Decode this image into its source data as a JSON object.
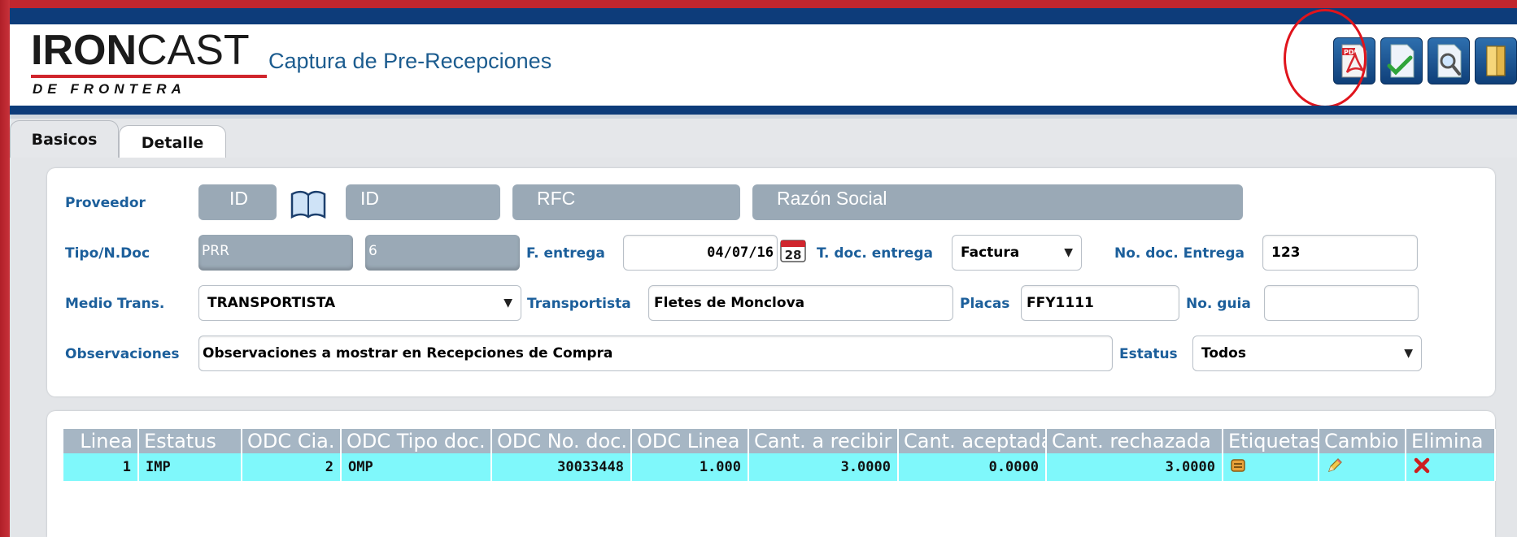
{
  "header": {
    "logo_main_bold": "IRON",
    "logo_main_regular": "CAST",
    "logo_sub": "DE FRONTERA",
    "title": "Captura de Pre-Recepciones",
    "toolbar_icons": [
      "pdf-icon",
      "document-check-icon",
      "magnifier-icon",
      "exit-door-icon"
    ]
  },
  "tabs": [
    {
      "label": "Basicos",
      "active": true
    },
    {
      "label": "Detalle",
      "active": false
    }
  ],
  "form": {
    "proveedor_label": "Proveedor",
    "proveedor_id_placeholder": "ID",
    "proveedor_id2_placeholder": "ID",
    "rfc_placeholder": "RFC",
    "razon_social_placeholder": "Razón Social",
    "tipo_ndoc_label": "Tipo/N.Doc",
    "tipo_value": "PRR",
    "ndoc_value": "6",
    "f_entrega_label": "F. entrega",
    "f_entrega_value": "04/07/16",
    "calendar_day": "28",
    "t_doc_entrega_label": "T. doc. entrega",
    "t_doc_entrega_value": "Factura",
    "no_doc_entrega_label": "No. doc. Entrega",
    "no_doc_entrega_value": "123",
    "medio_trans_label": "Medio Trans.",
    "medio_trans_value": "TRANSPORTISTA",
    "transportista_label": "Transportista",
    "transportista_value": "Fletes de Monclova",
    "placas_label": "Placas",
    "placas_value": "FFY1111",
    "no_guia_label": "No. guia",
    "no_guia_value": "",
    "observaciones_label": "Observaciones",
    "observaciones_value": "Observaciones a mostrar en Recepciones de Compra",
    "estatus_label": "Estatus",
    "estatus_value": "Todos"
  },
  "grid": {
    "columns": [
      "Linea",
      "Estatus",
      "ODC Cia.",
      "ODC Tipo doc.",
      "ODC No. doc.",
      "ODC Linea",
      "Cant. a recibir",
      "Cant. aceptada",
      "Cant. rechazada",
      "Etiquetas",
      "Cambio",
      "Elimina"
    ],
    "rows": [
      {
        "linea": "1",
        "estatus": "IMP",
        "odc_cia": "2",
        "odc_tipo_doc": "OMP",
        "odc_no_doc": "30033448",
        "odc_linea": "1.000",
        "cant_recibir": "3.0000",
        "cant_aceptada": "0.0000",
        "cant_rechazada": "3.0000",
        "etiquetas_icon": "label-print-icon",
        "cambio_icon": "pencil-icon",
        "elimina_icon": "delete-x-icon"
      }
    ]
  },
  "colors": {
    "brand_blue": "#0d3c7a",
    "frame_red": "#c0262e",
    "label_blue": "#1c5f9b",
    "row_highlight": "#7ff8fb",
    "header_gray": "#a6b6c4"
  }
}
